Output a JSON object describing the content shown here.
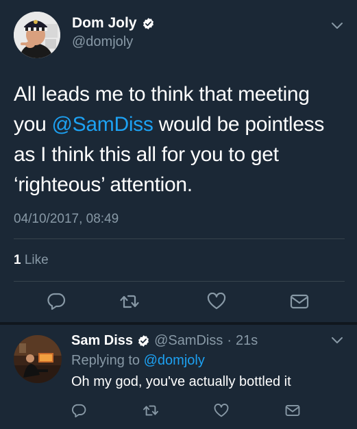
{
  "main_tweet": {
    "author": {
      "display_name": "Dom Joly",
      "handle": "@domjoly",
      "verified": true
    },
    "text_lines": [
      {
        "before": "All leads me to think that meeting",
        "mention": "",
        "after": ""
      },
      {
        "before": "you ",
        "mention": "@SamDiss",
        "after": " would be pointless"
      },
      {
        "before": "as I think this all for you to get",
        "mention": "",
        "after": ""
      },
      {
        "before": "‘righteous’ attention.",
        "mention": "",
        "after": ""
      }
    ],
    "timestamp": "04/10/2017, 08:49",
    "likes": {
      "count": "1",
      "label": "Like"
    },
    "actions": [
      "reply-icon",
      "retweet-icon",
      "like-icon",
      "message-icon"
    ],
    "menu_icon": "chevron-down-icon"
  },
  "reply_tweet": {
    "author": {
      "display_name": "Sam Diss",
      "handle": "@SamDiss",
      "verified": true
    },
    "separator": "·",
    "time_ago": "21s",
    "replying_to_label": "Replying to",
    "replying_to_handle": "@domjoly",
    "text": "Oh my god, you've actually bottled it",
    "actions": [
      "reply-icon",
      "retweet-icon",
      "like-icon",
      "message-icon"
    ],
    "menu_icon": "chevron-down-icon"
  },
  "colors": {
    "background": "#1b2836",
    "primary_text": "#ffffff",
    "secondary_text": "#8899a6",
    "link": "#1da1f2",
    "divider": "#38444d"
  }
}
